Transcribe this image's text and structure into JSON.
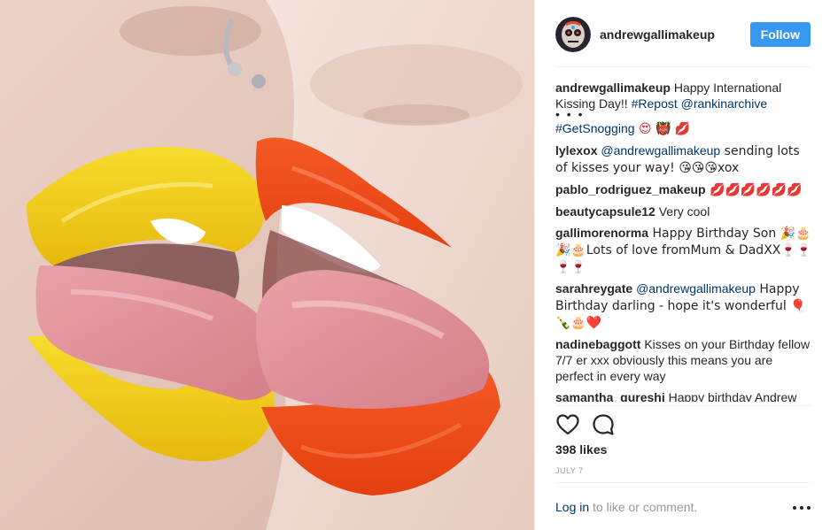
{
  "header": {
    "username": "andrewgallimakeup",
    "follow_label": "Follow"
  },
  "caption": {
    "username": "andrewgallimakeup",
    "text": " Happy International Kissing Day!! ",
    "hashtag_repost": "#Repost",
    "mention": "@rankinarchive",
    "dots": "• • •",
    "hashtag_snogging": "#GetSnogging",
    "emojis": " 😍 👹 💋"
  },
  "comments": [
    {
      "username": "lylexox",
      "mention": "@andrewgallimakeup",
      "text": " sending lots of kisses your way! 😘😘😘xox"
    },
    {
      "username": "pablo_rodriguez_makeup",
      "mention": "",
      "text": " 💋💋💋💋💋💋"
    },
    {
      "username": "beautycapsule12",
      "mention": "",
      "text": " Very cool"
    },
    {
      "username": "gallimorenorma",
      "mention": "",
      "text": " Happy Birthday Son 🎉🎂🎉🎂Lots of love fromMum & DadXX🍷🍷🍷🍷"
    },
    {
      "username": "sarahreygate",
      "mention": "@andrewgallimakeup",
      "text": " Happy Birthday darling - hope it's wonderful 🎈🍾🎂❤️"
    },
    {
      "username": "nadinebaggott",
      "mention": "",
      "text": " Kisses on your Birthday fellow 7/7 er xxx obviously this means you are perfect in every way"
    },
    {
      "username": "samantha_qureshi",
      "mention": "",
      "text": " Happy birthday Andrew"
    }
  ],
  "actions": {
    "like_icon": "heart-icon",
    "comment_icon": "comment-bubble-icon"
  },
  "likes": "398 likes",
  "date": "JULY 7",
  "footer": {
    "login_link": "Log in",
    "login_text": " to like or comment.",
    "more_icon": "more-options-icon"
  },
  "colors": {
    "follow_button": "#3897f0",
    "link": "#003569",
    "yellow_lips": "#f3d21a",
    "orange_lips": "#f0471c"
  }
}
